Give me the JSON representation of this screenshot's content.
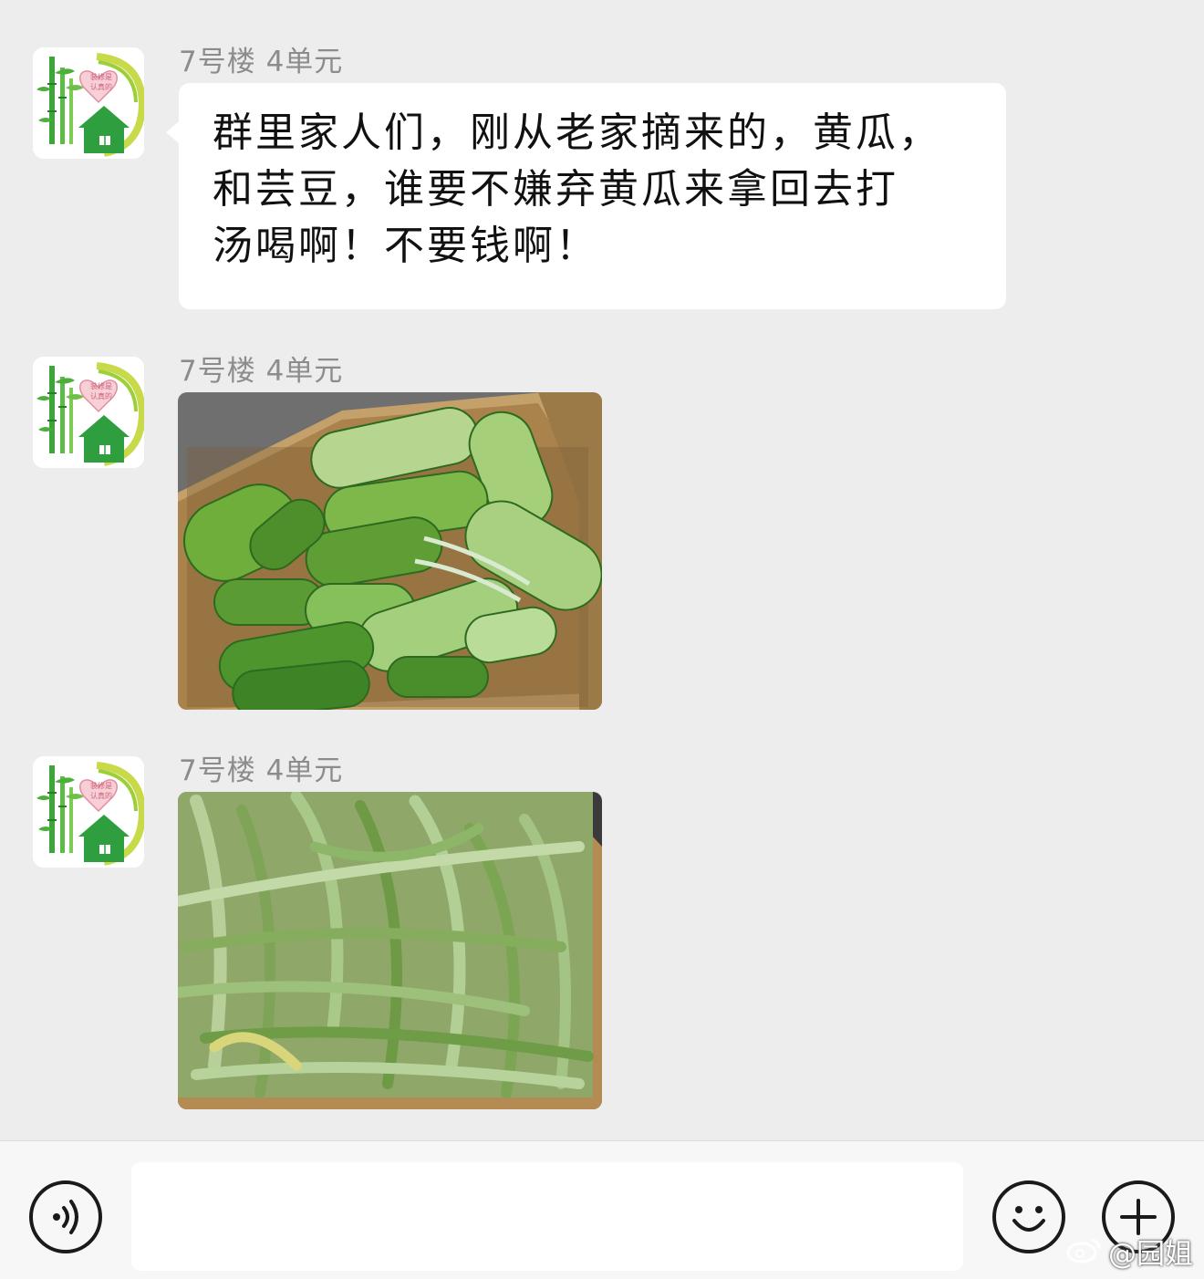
{
  "messages": [
    {
      "sender": "7号楼 4单元",
      "type": "text",
      "lines": [
        "群里家人们，刚从老家摘来的，黄瓜，",
        "和芸豆，谁要不嫌弃黄瓜来拿回去打",
        "汤喝啊！不要钱啊！"
      ]
    },
    {
      "sender": "7号楼 4单元",
      "type": "image",
      "image": "cucumbers-in-cardboard-box"
    },
    {
      "sender": "7号楼 4单元",
      "type": "image",
      "image": "kidney-beans-in-cardboard-box"
    }
  ],
  "avatar": {
    "icon": "bamboo-heart-house-icon",
    "heart_text": [
      "装修是",
      "认真的"
    ]
  },
  "input_bar": {
    "voice_icon": "voice-icon",
    "emoji_icon": "emoji-icon",
    "more_icon": "plus-icon",
    "input_value": ""
  },
  "watermark": "@园姐",
  "colors": {
    "background": "#ededed",
    "bubble": "#ffffff",
    "sender_text": "#8c8c8c",
    "avatar_green": "#2e9e3e"
  }
}
